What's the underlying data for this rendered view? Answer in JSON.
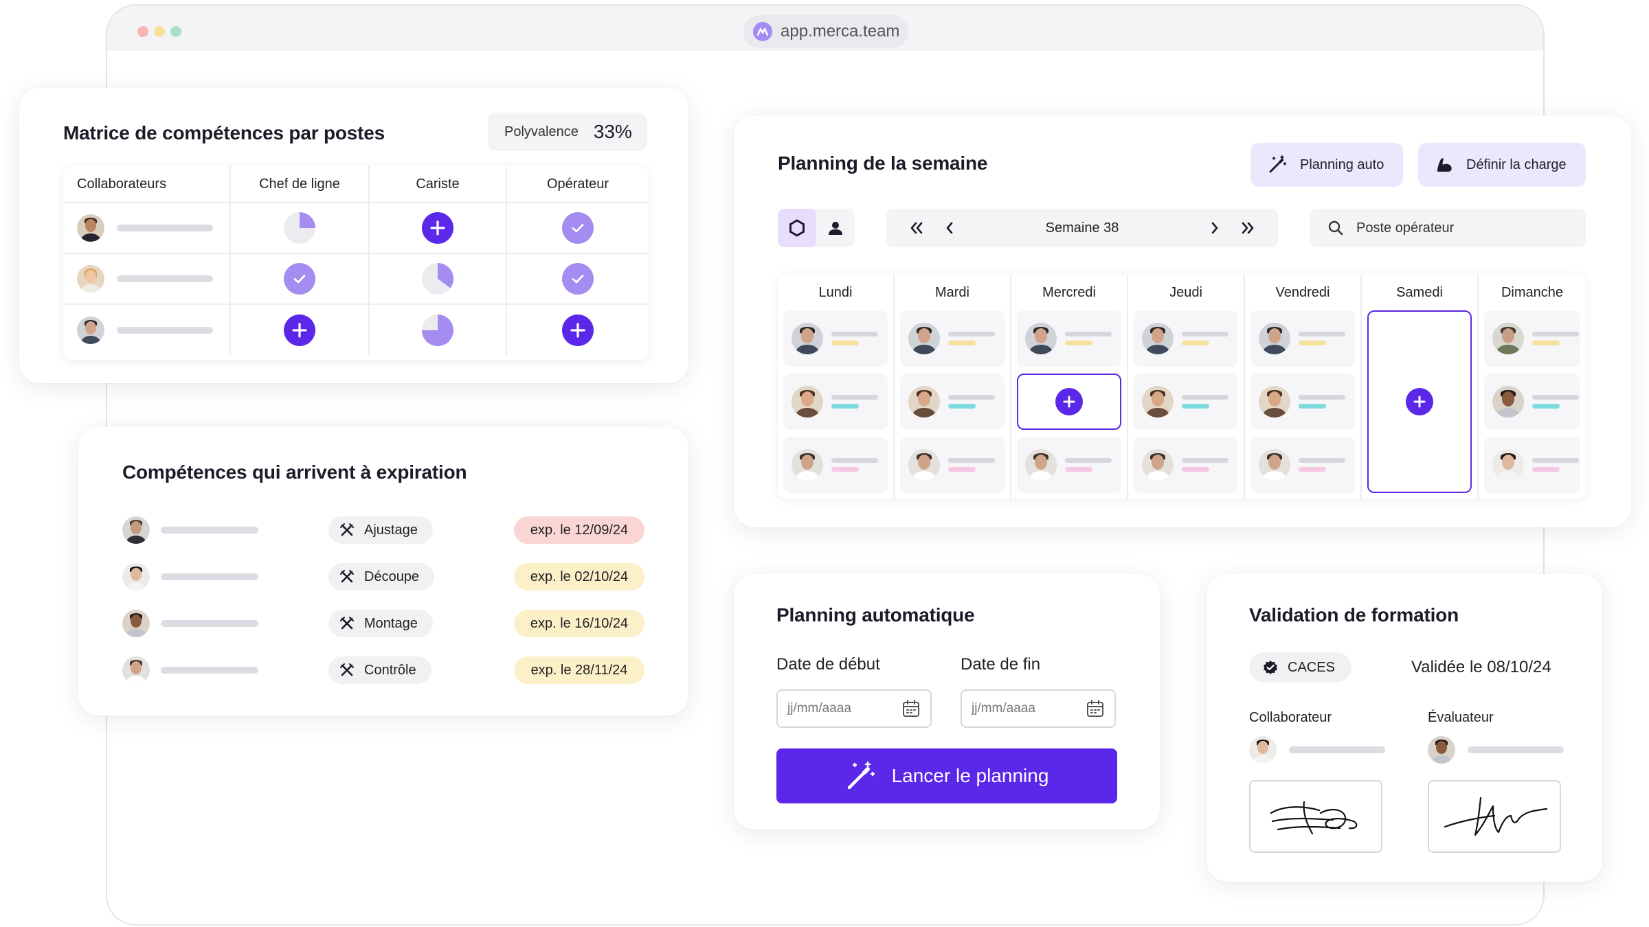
{
  "browser": {
    "url": "app.merca.team"
  },
  "matrice": {
    "title": "Matrice de compétences par postes",
    "polyvalence_label": "Polyvalence",
    "polyvalence_value": "33%",
    "columns": [
      "Collaborateurs",
      "Chef de ligne",
      "Cariste",
      "Opérateur"
    ],
    "rows": [
      {
        "cells": [
          "pie-25",
          "plus",
          "check"
        ]
      },
      {
        "cells": [
          "check",
          "pie-40",
          "check"
        ]
      },
      {
        "cells": [
          "plus",
          "pie-75",
          "plus"
        ]
      }
    ]
  },
  "expiration": {
    "title": "Compétences qui arrivent à expiration",
    "items": [
      {
        "skill": "Ajustage",
        "expiry": "exp. le 12/09/24",
        "status": "urgent"
      },
      {
        "skill": "Découpe",
        "expiry": "exp. le 02/10/24",
        "status": "warning"
      },
      {
        "skill": "Montage",
        "expiry": "exp. le 16/10/24",
        "status": "warning"
      },
      {
        "skill": "Contrôle",
        "expiry": "exp. le 28/11/24",
        "status": "warning"
      }
    ]
  },
  "semaine": {
    "title": "Planning de la semaine",
    "planning_auto_label": "Planning auto",
    "definir_charge_label": "Définir la charge",
    "week_label": "Semaine 38",
    "search_placeholder": "Poste opérateur",
    "days": [
      "Lundi",
      "Mardi",
      "Mercredi",
      "Jeudi",
      "Vendredi",
      "Samedi",
      "Dimanche"
    ]
  },
  "auto": {
    "title": "Planning automatique",
    "start_label": "Date de début",
    "end_label": "Date de fin",
    "date_placeholder": "jj/mm/aaaa",
    "launch_label": "Lancer le planning"
  },
  "validation": {
    "title": "Validation de formation",
    "badge": "CACES",
    "validated": "Validée le 08/10/24",
    "collaborateur_label": "Collaborateur",
    "evaluateur_label": "Évaluateur"
  },
  "colors": {
    "primary": "#5b27e8",
    "lilac": "#a48cf0",
    "urgent_bg": "#f9d6d4",
    "warning_bg": "#fbf0c8",
    "line_yellow": "#f6e19a",
    "line_cyan": "#7fdbe0",
    "line_pink": "#f6c8e4"
  }
}
